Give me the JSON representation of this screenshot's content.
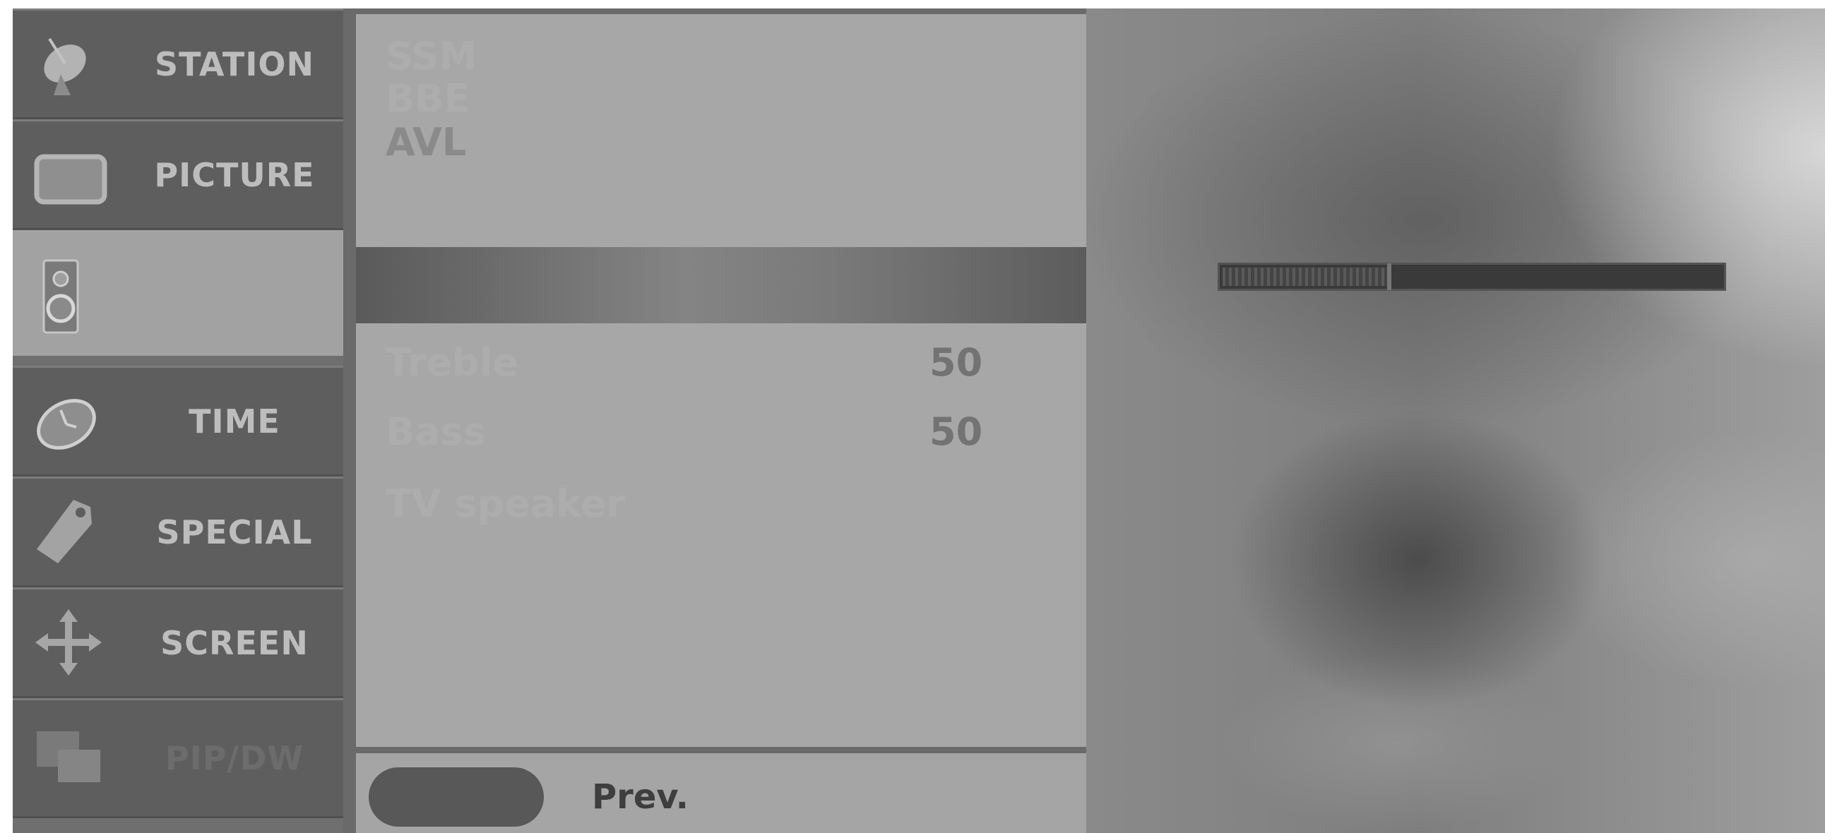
{
  "sidebar": {
    "items": [
      {
        "label": "STATION",
        "icon": "satellite-dish-icon"
      },
      {
        "label": "PICTURE",
        "icon": "tv-screen-icon"
      },
      {
        "label": "",
        "icon": "speaker-icon",
        "selected": true
      },
      {
        "label": "TIME",
        "icon": "clock-icon"
      },
      {
        "label": "SPECIAL",
        "icon": "tag-icon"
      },
      {
        "label": "SCREEN",
        "icon": "move-arrows-icon"
      },
      {
        "label": "PIP/DW",
        "icon": "pip-windows-icon"
      }
    ]
  },
  "submenu": {
    "items": [
      {
        "label": "SSM",
        "value": ""
      },
      {
        "label": "BBE",
        "value": ""
      },
      {
        "label": "AVL",
        "value": ""
      },
      {
        "label": "Treble",
        "value": "50"
      },
      {
        "label": "Bass",
        "value": "50"
      },
      {
        "label": "TV speaker",
        "value": ""
      }
    ],
    "footer": {
      "prev_label": "Prev."
    }
  },
  "preview": {
    "level": 0.33
  },
  "colors": {
    "selected_category": "#a2a2a2",
    "menu_background": "#a7a7a7",
    "unselected_category": "#5e5e5e"
  }
}
